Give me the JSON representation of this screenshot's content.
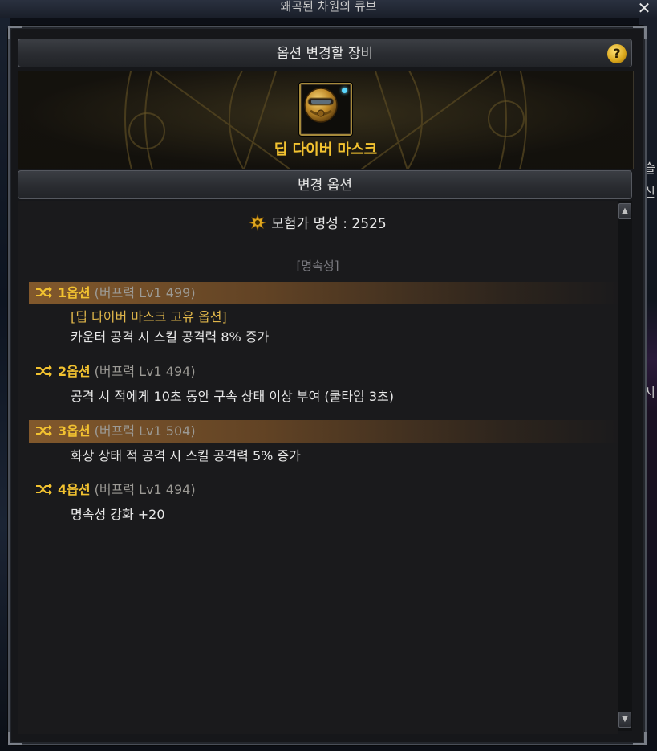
{
  "window": {
    "title": "왜곡된 차원의 큐브",
    "close_label": "✕"
  },
  "header": {
    "title": "옵션 변경할 장비",
    "help_label": "?"
  },
  "item": {
    "name": "딥 다이버 마스크",
    "icon": "diving-helmet-icon",
    "gem_color": "#5ad7ff"
  },
  "options_header": {
    "title": "변경 옵션"
  },
  "fame": {
    "label": "모험가 명성 : 2525",
    "icon": "fame-crest-icon"
  },
  "element_label": "[명속성]",
  "options": [
    {
      "num": "1옵션",
      "type": "(버프력 Lv1 499)",
      "highlighted": true,
      "lines": [
        "[딥 다이버 마스크 고유 옵션]",
        "카운터 공격 시 스킬 공격력 8% 증가"
      ]
    },
    {
      "num": "2옵션",
      "type": "(버프력 Lv1 494)",
      "highlighted": false,
      "lines": [
        "공격 시 적에게 10초 동안 구속 상태 이상 부여 (쿨타임 3초)"
      ]
    },
    {
      "num": "3옵션",
      "type": "(버프력 Lv1 504)",
      "highlighted": true,
      "lines": [
        "화상 상태 적 공격 시 스킬 공격력 5% 증가"
      ]
    },
    {
      "num": "4옵션",
      "type": "(버프력 Lv1 494)",
      "highlighted": false,
      "lines": [
        "명속성 강화 +20"
      ]
    }
  ],
  "scrollbar": {
    "up_label": "▲",
    "down_label": "▼"
  },
  "background": {
    "right_edge_text": [
      "슬",
      "신",
      "시"
    ]
  },
  "colors": {
    "accent_gold": "#f2c230",
    "highlight_bronze": "#875c2d",
    "text_main": "#e8e8e8",
    "text_dim": "#9c9a95"
  }
}
